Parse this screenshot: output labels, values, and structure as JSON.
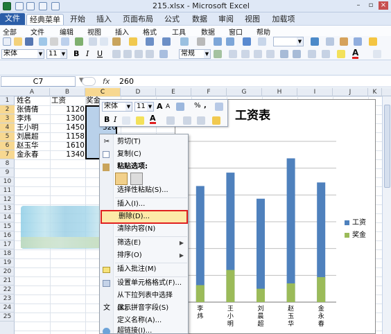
{
  "window": {
    "title": "215.xlsx - Microsoft Excel"
  },
  "ribbon_tabs": [
    "文件",
    "经典菜单",
    "开始",
    "插入",
    "页面布局",
    "公式",
    "数据",
    "审阅",
    "视图",
    "加载项"
  ],
  "menu_items": [
    "全部",
    "文件",
    "编辑",
    "视图",
    "插入",
    "格式",
    "工具",
    "数据",
    "窗口",
    "帮助"
  ],
  "toolbar": {
    "font": "宋体",
    "size": "11",
    "bold": "B",
    "italic": "I",
    "underline": "U",
    "number_format": "常规"
  },
  "formula_bar": {
    "name_box": "C7",
    "fx": "fx",
    "value": "260"
  },
  "columns": [
    "A",
    "B",
    "C",
    "D",
    "E",
    "F",
    "G",
    "H",
    "I",
    "J",
    "K"
  ],
  "rows": [
    "1",
    "2",
    "3",
    "4",
    "5",
    "6",
    "7",
    "8",
    "9",
    "10",
    "11",
    "12",
    "13",
    "14",
    "15",
    "16",
    "17",
    "18",
    "19",
    "20",
    "21",
    "22",
    "23",
    "24",
    "25"
  ],
  "sheet": {
    "headers": {
      "a": "姓名",
      "b": "工资",
      "c": "奖金"
    },
    "names": [
      "张倩倩",
      "李炜",
      "王小明",
      "刘晨超",
      "赵玉华",
      "金永春"
    ],
    "salaries": [
      "1120",
      "1300",
      "1450",
      "1158",
      "1610",
      "1340"
    ],
    "c4": "320"
  },
  "mini_toolbar": {
    "font": "宋体",
    "size": "11",
    "grow": "A",
    "shrink": "A",
    "percent": "%",
    "comma": ",",
    "bold": "B",
    "italic": "I",
    "font_color": "A"
  },
  "context_menu": {
    "cut": "剪切(T)",
    "copy": "复制(C)",
    "paste_options": "粘贴选项:",
    "paste_special": "选择性粘贴(S)...",
    "insert": "插入(I)...",
    "delete": "删除(D)...",
    "clear": "清除内容(N)",
    "filter": "筛选(E)",
    "sort": "排序(O)",
    "comment": "插入批注(M)",
    "format_cells": "设置单元格格式(F)...",
    "pick_list": "从下拉列表中选择(K)...",
    "phonetic": "显示拼音字段(S)",
    "define_name": "定义名称(A)...",
    "hyperlink": "超链接(I)..."
  },
  "chart_data": {
    "type": "bar",
    "title": "工资表",
    "categories": [
      "李炜",
      "王小明",
      "刘晨超",
      "赵玉华",
      "金永春"
    ],
    "series": [
      {
        "name": "工资",
        "color": "#4f81bd",
        "values": [
          1300,
          1450,
          1158,
          1610,
          1340
        ]
      },
      {
        "name": "奖金",
        "color": "#9bbb59",
        "values": [
          190,
          360,
          150,
          210,
          280
        ]
      }
    ],
    "ylim": [
      0,
      1800
    ],
    "grid": true,
    "legend": "right"
  }
}
